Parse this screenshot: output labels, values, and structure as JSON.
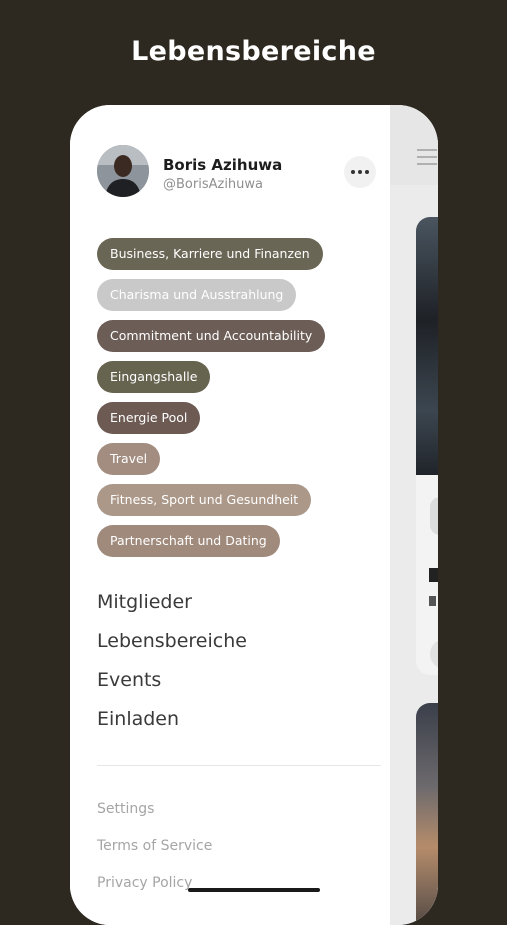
{
  "headline": "Lebensbereiche",
  "user": {
    "name": "Boris Azihuwa",
    "handle": "@BorisAzihuwa"
  },
  "more_icon": "more-horizontal-icon",
  "tags": [
    {
      "label": "Business, Karriere und Finanzen",
      "color": "#6a6655"
    },
    {
      "label": "Charisma und Ausstrahlung",
      "color": "#c9c9c9"
    },
    {
      "label": "Commitment und Accountability",
      "color": "#6c5d56"
    },
    {
      "label": "Eingangshalle",
      "color": "#66634f"
    },
    {
      "label": "Energie Pool",
      "color": "#6c5a53"
    },
    {
      "label": "Travel",
      "color": "#a38d80"
    },
    {
      "label": "Fitness, Sport und Gesundheit",
      "color": "#ab9889"
    },
    {
      "label": "Partnerschaft und Dating",
      "color": "#a08a7c"
    }
  ],
  "nav": [
    "Mitglieder",
    "Lebensbereiche",
    "Events",
    "Einladen"
  ],
  "footer": [
    "Settings",
    "Terms of Service",
    "Privacy Policy"
  ]
}
